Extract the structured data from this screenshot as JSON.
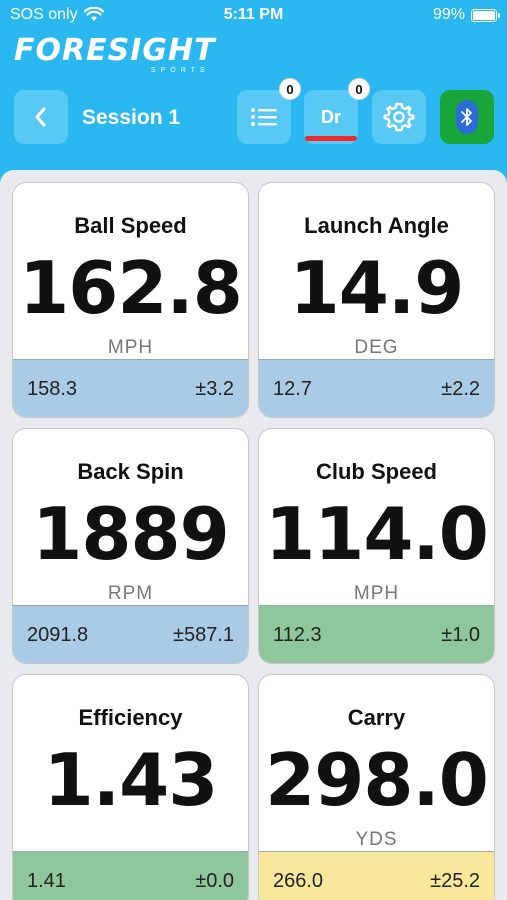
{
  "status_bar": {
    "carrier": "SOS only",
    "time": "5:11 PM",
    "battery_text": "99%",
    "battery_level": 0.99
  },
  "brand": {
    "logo_main": "FORESIGHT",
    "logo_sub": "SPORTS"
  },
  "toolbar": {
    "session_title": "Session 1",
    "shot_list_count": "0",
    "club_label": "Dr",
    "club_count": "0"
  },
  "colors": {
    "header_bg": "#2bb8f0",
    "footer_blue": "#a9cbe6",
    "footer_green": "#8fc79c",
    "footer_yellow": "#f7e79a",
    "bluetooth_green": "#17a63a",
    "club_underline": "#f0292c"
  },
  "metrics": [
    {
      "label": "Ball Speed",
      "value": "162.8",
      "unit": "MPH",
      "avg": "158.3",
      "dev": "±3.2",
      "footer_color": "#a9cbe6"
    },
    {
      "label": "Launch Angle",
      "value": "14.9",
      "unit": "DEG",
      "avg": "12.7",
      "dev": "±2.2",
      "footer_color": "#a9cbe6"
    },
    {
      "label": "Back Spin",
      "value": "1889",
      "unit": "RPM",
      "avg": "2091.8",
      "dev": "±587.1",
      "footer_color": "#a9cbe6"
    },
    {
      "label": "Club Speed",
      "value": "114.0",
      "unit": "MPH",
      "avg": "112.3",
      "dev": "±1.0",
      "footer_color": "#8fc79c"
    },
    {
      "label": "Efficiency",
      "value": "1.43",
      "unit": "",
      "avg": "1.41",
      "dev": "±0.0",
      "footer_color": "#8fc79c"
    },
    {
      "label": "Carry",
      "value": "298.0",
      "unit": "YDS",
      "avg": "266.0",
      "dev": "±25.2",
      "footer_color": "#f7e79a"
    }
  ],
  "icons": {
    "wifi": "wifi-icon",
    "battery": "battery-icon",
    "back": "chevron-left-icon",
    "list": "list-icon",
    "settings": "gear-icon",
    "bluetooth": "bluetooth-icon"
  }
}
